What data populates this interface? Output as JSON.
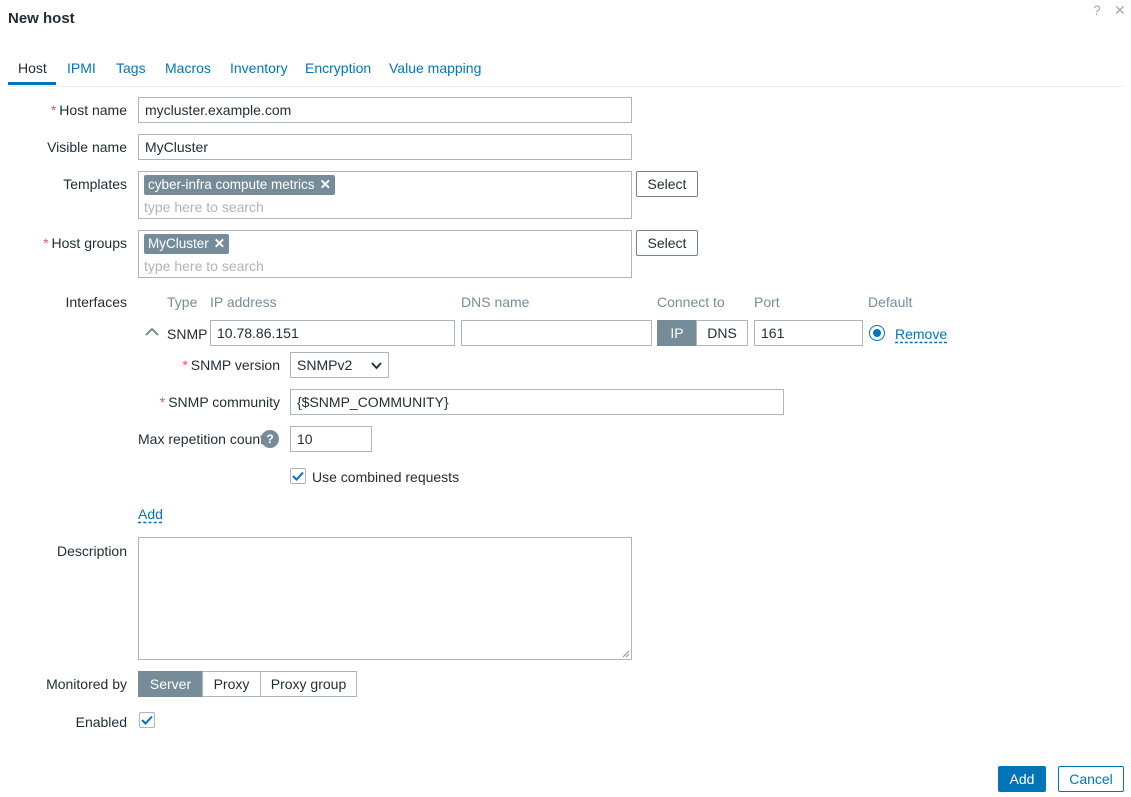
{
  "dialog": {
    "title": "New host",
    "help_glyph": "?",
    "close_glyph": "✕"
  },
  "tabs": [
    {
      "label": "Host"
    },
    {
      "label": "IPMI"
    },
    {
      "label": "Tags"
    },
    {
      "label": "Macros"
    },
    {
      "label": "Inventory"
    },
    {
      "label": "Encryption"
    },
    {
      "label": "Value mapping"
    }
  ],
  "form": {
    "required_mark": "*",
    "host_name": {
      "label": "Host name",
      "value": "mycluster.example.com"
    },
    "visible_name": {
      "label": "Visible name",
      "value": "MyCluster"
    },
    "templates": {
      "label": "Templates",
      "chips": [
        "cyber-infra compute metrics"
      ],
      "placeholder": "type here to search",
      "select_label": "Select"
    },
    "host_groups": {
      "label": "Host groups",
      "chips": [
        "MyCluster"
      ],
      "placeholder": "type here to search",
      "select_label": "Select"
    },
    "interfaces": {
      "label": "Interfaces",
      "columns": [
        "Type",
        "IP address",
        "DNS name",
        "Connect to",
        "Port",
        "Default"
      ],
      "row": {
        "type": "SNMP",
        "ip": "10.78.86.151",
        "dns": "",
        "connect_options": [
          "IP",
          "DNS"
        ],
        "connect_selected": "IP",
        "port": "161",
        "remove_label": "Remove"
      },
      "snmp_version": {
        "label": "SNMP version",
        "value": "SNMPv2"
      },
      "snmp_community": {
        "label": "SNMP community",
        "value": "{$SNMP_COMMUNITY}"
      },
      "max_repetition": {
        "label": "Max repetition count",
        "value": "10",
        "help_glyph": "?"
      },
      "combined_requests": {
        "label": "Use combined requests",
        "checked": true
      },
      "add_label": "Add"
    },
    "description": {
      "label": "Description",
      "value": ""
    },
    "monitored_by": {
      "label": "Monitored by",
      "options": [
        "Server",
        "Proxy",
        "Proxy group"
      ],
      "selected": "Server"
    },
    "enabled": {
      "label": "Enabled",
      "checked": true
    }
  },
  "footer": {
    "add_label": "Add",
    "cancel_label": "Cancel"
  },
  "colors": {
    "accent": "#0275b8",
    "chip": "#768d99",
    "required": "#e45959"
  }
}
